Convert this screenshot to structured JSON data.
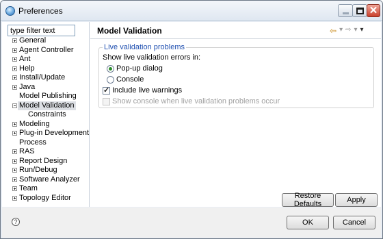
{
  "window": {
    "title": "Preferences"
  },
  "sidebar": {
    "filter_value": "type filter text",
    "items": [
      {
        "label": "General",
        "expander": "plus"
      },
      {
        "label": "Agent Controller",
        "expander": "plus"
      },
      {
        "label": "Ant",
        "expander": "plus"
      },
      {
        "label": "Help",
        "expander": "plus"
      },
      {
        "label": "Install/Update",
        "expander": "plus"
      },
      {
        "label": "Java",
        "expander": "plus"
      },
      {
        "label": "Model Publishing",
        "expander": "none"
      },
      {
        "label": "Model Validation",
        "expander": "minus",
        "selected": true
      },
      {
        "label": "Constraints",
        "expander": "none",
        "child": true
      },
      {
        "label": "Modeling",
        "expander": "plus"
      },
      {
        "label": "Plug-in Development",
        "expander": "plus"
      },
      {
        "label": "Process",
        "expander": "none"
      },
      {
        "label": "RAS",
        "expander": "plus"
      },
      {
        "label": "Report Design",
        "expander": "plus"
      },
      {
        "label": "Run/Debug",
        "expander": "plus"
      },
      {
        "label": "Software Analyzer",
        "expander": "plus"
      },
      {
        "label": "Team",
        "expander": "plus"
      },
      {
        "label": "Topology Editor",
        "expander": "plus"
      }
    ]
  },
  "main": {
    "title": "Model Validation",
    "group_title": "Live validation problems",
    "show_errors_label": "Show live validation errors in:",
    "radio_popup": "Pop-up dialog",
    "radio_console": "Console",
    "include_warnings": "Include live warnings",
    "show_console": "Show console when live validation problems occur",
    "restore_defaults": "Restore Defaults",
    "apply": "Apply"
  },
  "footer": {
    "ok": "OK",
    "cancel": "Cancel",
    "help_glyph": "?"
  },
  "colors": {
    "accent": "#1f4fb0",
    "selected_bg": "#dcdfe4"
  }
}
